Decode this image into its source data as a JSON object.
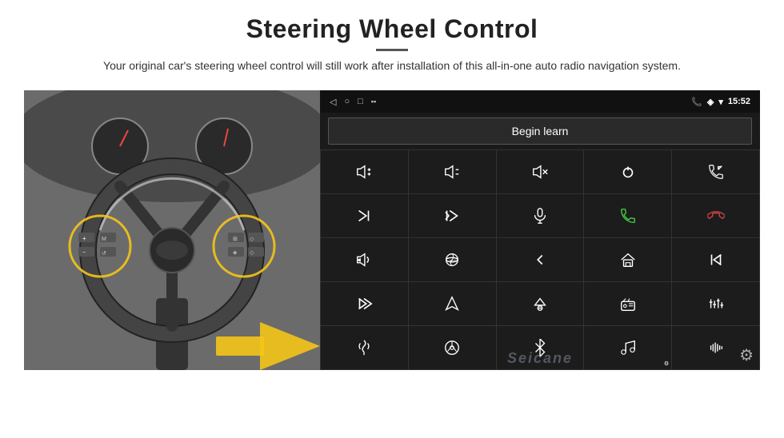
{
  "header": {
    "title": "Steering Wheel Control",
    "divider": true,
    "subtitle": "Your original car's steering wheel control will still work after installation of this all-in-one auto radio navigation system."
  },
  "status_bar": {
    "nav_back": "◁",
    "nav_home": "○",
    "nav_square": "□",
    "signal": "▪▪",
    "phone_icon": "📞",
    "location_icon": "◈",
    "wifi_icon": "▾",
    "time": "15:52"
  },
  "begin_learn": {
    "label": "Begin learn"
  },
  "watermark": "Seicane",
  "icons": [
    {
      "name": "vol-up",
      "row": 1,
      "col": 1
    },
    {
      "name": "vol-down",
      "row": 1,
      "col": 2
    },
    {
      "name": "mute",
      "row": 1,
      "col": 3
    },
    {
      "name": "power",
      "row": 1,
      "col": 4
    },
    {
      "name": "phone-prev",
      "row": 1,
      "col": 5
    },
    {
      "name": "next-track",
      "row": 2,
      "col": 1
    },
    {
      "name": "prev-mute",
      "row": 2,
      "col": 2
    },
    {
      "name": "mic",
      "row": 2,
      "col": 3
    },
    {
      "name": "phone-accept",
      "row": 2,
      "col": 4
    },
    {
      "name": "phone-end",
      "row": 2,
      "col": 5
    },
    {
      "name": "speaker",
      "row": 3,
      "col": 1
    },
    {
      "name": "360-view",
      "row": 3,
      "col": 2
    },
    {
      "name": "back",
      "row": 3,
      "col": 3
    },
    {
      "name": "home",
      "row": 3,
      "col": 4
    },
    {
      "name": "skip-back",
      "row": 3,
      "col": 5
    },
    {
      "name": "fast-forward",
      "row": 4,
      "col": 1
    },
    {
      "name": "navigate",
      "row": 4,
      "col": 2
    },
    {
      "name": "eject",
      "row": 4,
      "col": 3
    },
    {
      "name": "radio",
      "row": 4,
      "col": 4
    },
    {
      "name": "equalizer",
      "row": 4,
      "col": 5
    },
    {
      "name": "mic2",
      "row": 5,
      "col": 1
    },
    {
      "name": "steering",
      "row": 5,
      "col": 2
    },
    {
      "name": "bluetooth",
      "row": 5,
      "col": 3
    },
    {
      "name": "music",
      "row": 5,
      "col": 4
    },
    {
      "name": "waveform",
      "row": 5,
      "col": 5
    }
  ]
}
